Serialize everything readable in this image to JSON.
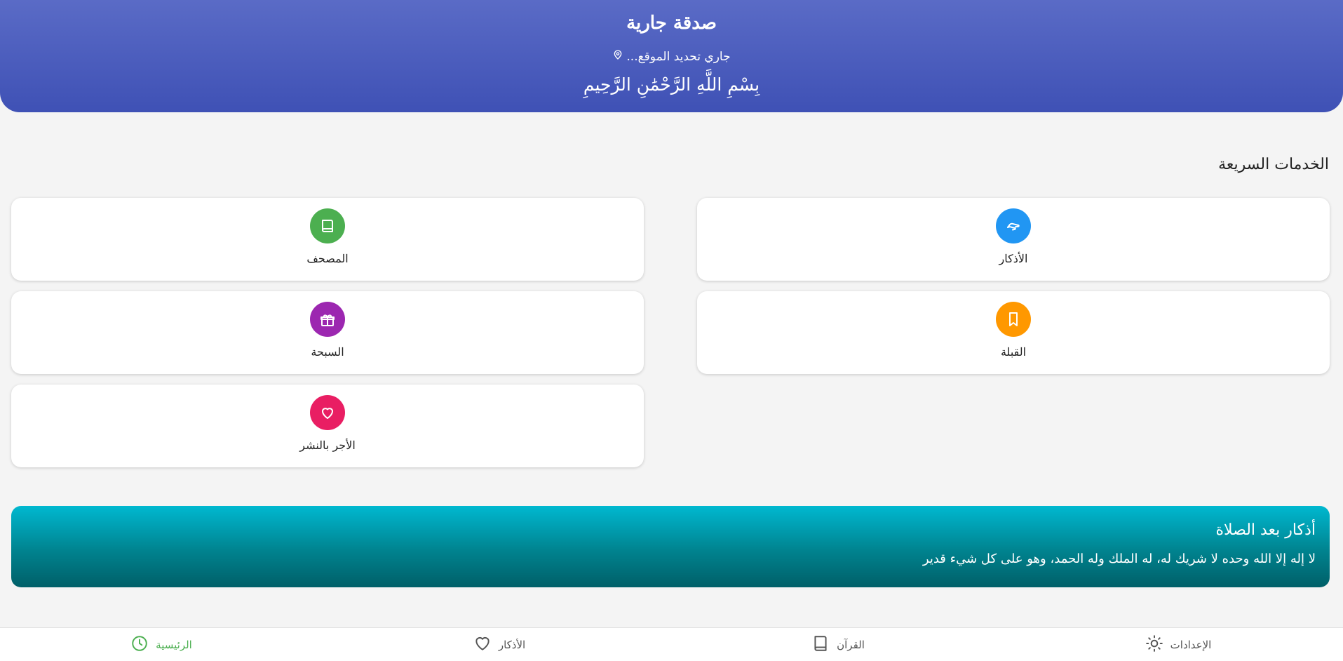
{
  "header": {
    "title": "صدقة جارية",
    "location": "جاري تحديد الموقع...",
    "location_icon": "map-pin-icon",
    "basmala": "بِسْمِ اللَّهِ الرَّحْمَٰنِ الرَّحِيمِ",
    "color": "#3f51b5"
  },
  "quick_services": {
    "title": "الخدمات السريعة",
    "items": [
      {
        "label": "الأذكار",
        "icon": "hand-icon",
        "color": "#2196f3"
      },
      {
        "label": "المصحف",
        "icon": "book-icon",
        "color": "#4caf50"
      },
      {
        "label": "القبلة",
        "icon": "bookmark-icon",
        "color": "#ff9800"
      },
      {
        "label": "السبحة",
        "icon": "gift-icon",
        "color": "#9c27b0"
      },
      {
        "label": "الأجر بالنشر",
        "icon": "heart-icon",
        "color": "#e91e63"
      }
    ]
  },
  "banner": {
    "title": "أذكار بعد الصلاة",
    "text": "لا إله إلا الله وحده لا شريك له، له الملك وله الحمد، وهو على كل شيء قدير",
    "color": "#00838f"
  },
  "bottom_nav": {
    "items": [
      {
        "label": "الرئيسية",
        "icon": "clock-icon",
        "active": true
      },
      {
        "label": "الأذكار",
        "icon": "heart-icon",
        "active": false
      },
      {
        "label": "القرآن",
        "icon": "book-icon",
        "active": false
      },
      {
        "label": "الإعدادات",
        "icon": "sun-icon",
        "active": false
      }
    ],
    "active_color": "#4caf50"
  }
}
